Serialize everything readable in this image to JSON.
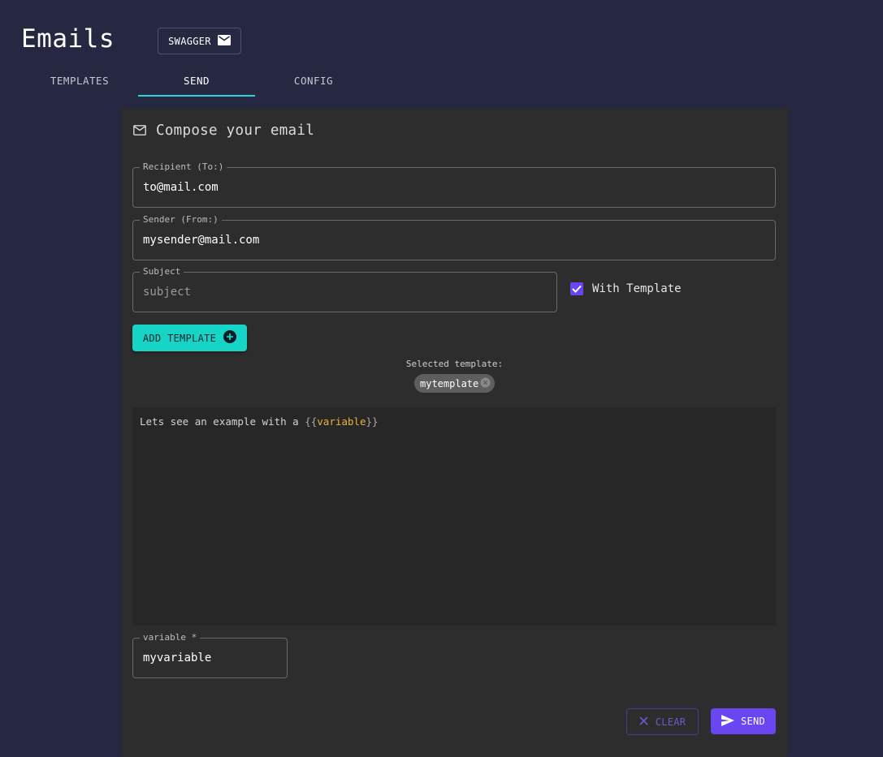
{
  "header": {
    "title": "Emails",
    "swagger_label": "SWAGGER",
    "swagger_icon": "mail-icon"
  },
  "tabs": [
    {
      "label": "TEMPLATES",
      "active": false
    },
    {
      "label": "SEND",
      "active": true
    },
    {
      "label": "CONFIG",
      "active": false
    }
  ],
  "compose": {
    "title": "Compose your email",
    "title_icon": "mail-outline-icon",
    "recipient": {
      "label": "Recipient (To:)",
      "value": "to@mail.com"
    },
    "sender": {
      "label": "Sender (From:)",
      "value": "mysender@mail.com"
    },
    "subject": {
      "label": "Subject",
      "value": "",
      "placeholder": "subject"
    },
    "with_template": {
      "label": "With Template",
      "checked": true
    },
    "add_template_label": "ADD TEMPLATE",
    "selected_template_label": "Selected template:",
    "selected_template": "mytemplate",
    "editor": {
      "prefix": "Lets see an example with a ",
      "open_brace": "{{",
      "variable": "variable",
      "close_brace": "}}"
    },
    "variable_field": {
      "label": "variable",
      "required_mark": "*",
      "value": "myvariable"
    },
    "clear_label": "CLEAR",
    "send_label": "SEND"
  },
  "colors": {
    "background": "#262841",
    "card": "#2d2d2d",
    "accent_teal": "#16d5c6",
    "accent_purple": "#6a46f2",
    "tab_indicator": "#2bd4d7",
    "variable_highlight": "#e7b33d"
  }
}
